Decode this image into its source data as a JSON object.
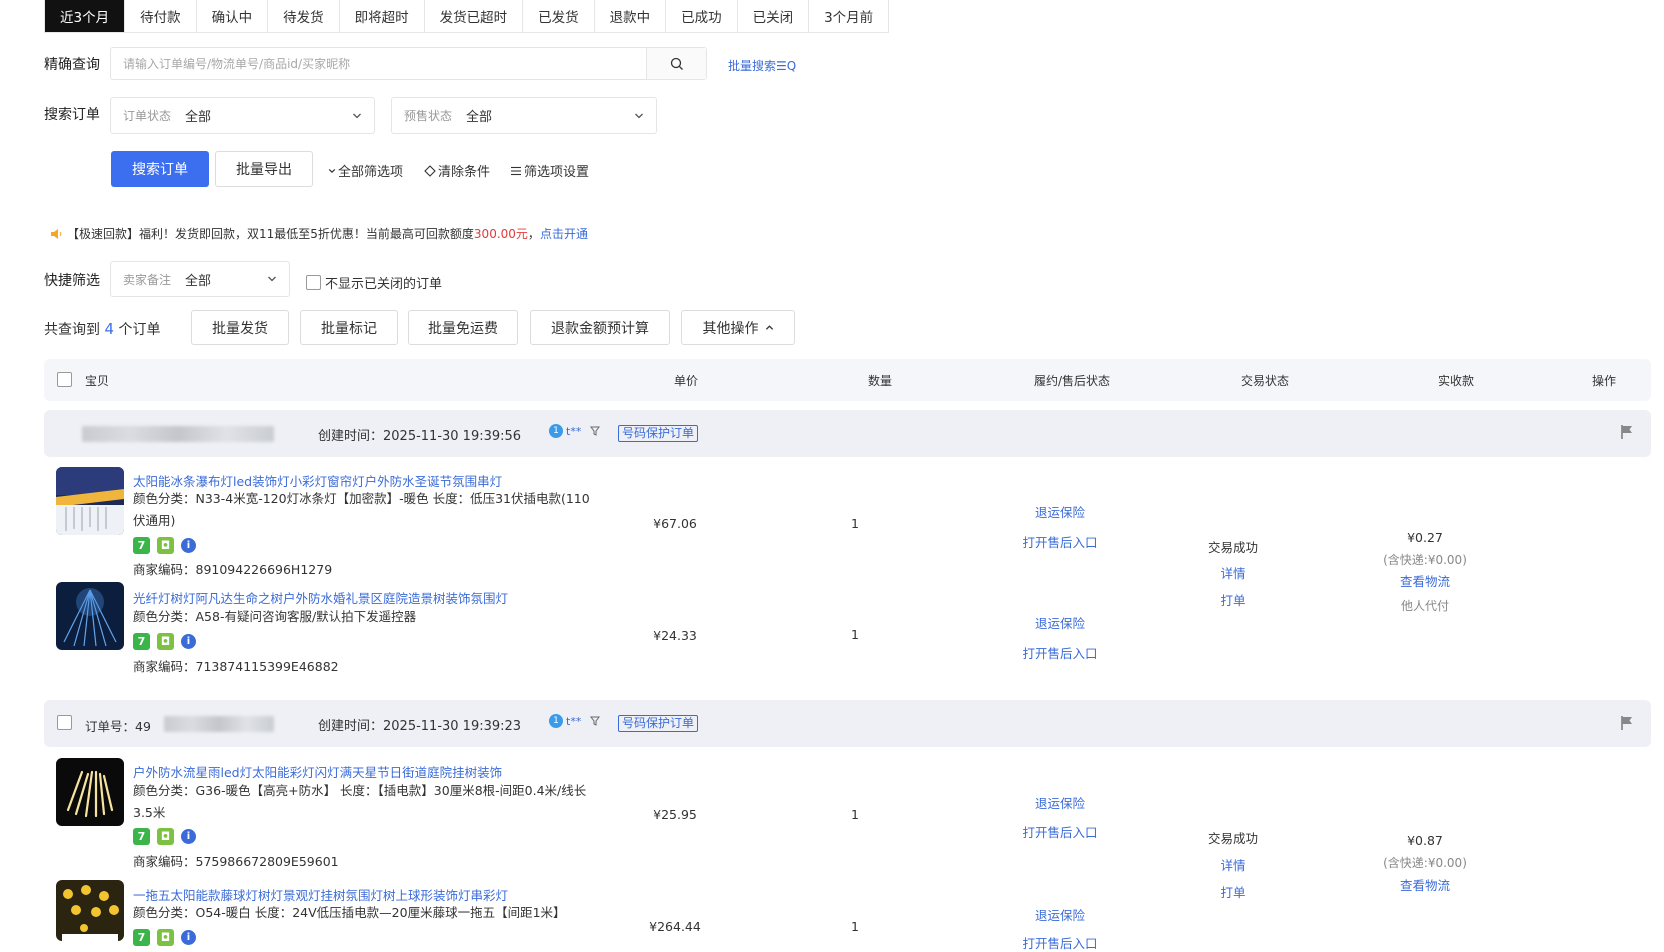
{
  "tabs": [
    {
      "label": "近3个月",
      "active": true
    },
    {
      "label": "待付款"
    },
    {
      "label": "确认中"
    },
    {
      "label": "待发货"
    },
    {
      "label": "即将超时"
    },
    {
      "label": "发货已超时"
    },
    {
      "label": "已发货"
    },
    {
      "label": "退款中"
    },
    {
      "label": "已成功"
    },
    {
      "label": "已关闭"
    },
    {
      "label": "3个月前"
    }
  ],
  "precise_query": {
    "label": "精确查询",
    "placeholder": "请输入订单编号/物流单号/商品id/买家昵称",
    "batch_search": "批量搜索☰Q"
  },
  "search_orders": {
    "label": "搜索订单",
    "order_status": {
      "label": "订单状态",
      "value": "全部"
    },
    "presale_status": {
      "label": "预售状态",
      "value": "全部"
    }
  },
  "actions": {
    "search": "搜索订单",
    "export": "批量导出",
    "all_filters": "全部筛选项",
    "clear": "清除条件",
    "filter_settings": "筛选项设置"
  },
  "notice": {
    "prefix": "【极速回款】福利！发货即回款，双11最低至5折优惠！当前最高可回款额度",
    "amount": "300.00元",
    "comma": "，",
    "link": "点击开通"
  },
  "quick_filter": {
    "label": "快捷筛选",
    "remark": {
      "label": "卖家备注",
      "value": "全部"
    },
    "hide_closed": "不显示已关闭的订单"
  },
  "summary": {
    "prefix": "共查询到",
    "count": "4",
    "suffix": "个订单"
  },
  "bulk_actions": [
    "批量发货",
    "批量标记",
    "批量免运费",
    "退款金额预计算",
    "其他操作"
  ],
  "table_headers": {
    "item": "宝贝",
    "price": "单价",
    "qty": "数量",
    "fulfillment": "履约/售后状态",
    "trade": "交易状态",
    "received": "实收款",
    "ops": "操作"
  },
  "orders": [
    {
      "order_no_label": "",
      "created": "创建时间：2025-11-30 19:39:56",
      "buyer": "t**",
      "tag": "号码保护订单",
      "trade_status": "交易成功",
      "detail": "详情",
      "print": "打单",
      "amount": "¥0.27",
      "shipping": "(含快递:¥0.00)",
      "logistics": "查看物流",
      "proxy": "他人代付",
      "items": [
        {
          "title": "太阳能冰条瀑布灯led装饰灯小彩灯窗帘灯户外防水圣诞节氛围串灯",
          "attr1": "颜色分类：N33-4米宽-120灯冰条灯【加密款】-暖色   长度：低压31伏插电款(110",
          "attr2": "伏通用)",
          "code": "商家编码：891094226696H1279",
          "price": "¥67.06",
          "qty": "1",
          "insurance": "退运保险",
          "after_sale": "打开售后入口"
        },
        {
          "title": "光纤灯树灯阿凡达生命之树户外防水婚礼景区庭院造景树装饰氛围灯",
          "attr1": "颜色分类：A58-有疑问咨询客服/默认拍下发遥控器",
          "attr2": "",
          "code": "商家编码：713874115399E46882",
          "price": "¥24.33",
          "qty": "1",
          "insurance": "退运保险",
          "after_sale": "打开售后入口"
        }
      ]
    },
    {
      "order_no_label": "订单号：49",
      "created": "创建时间：2025-11-30 19:39:23",
      "buyer": "t**",
      "tag": "号码保护订单",
      "trade_status": "交易成功",
      "detail": "详情",
      "print": "打单",
      "amount": "¥0.87",
      "shipping": "(含快递:¥0.00)",
      "logistics": "查看物流",
      "items": [
        {
          "title": "户外防水流星雨led灯太阳能彩灯闪灯满天星节日街道庭院挂树装饰",
          "attr1": "颜色分类：G36-暖色【高亮+防水】   长度：【插电款】30厘米8根-间距0.4米/线长",
          "attr2": "3.5米",
          "code": "商家编码：575986672809E59601",
          "price": "¥25.95",
          "qty": "1",
          "insurance": "退运保险",
          "after_sale": "打开售后入口"
        },
        {
          "title": "一拖五太阳能款藤球灯树灯景观灯挂树氛围灯树上球形装饰灯串彩灯",
          "attr1": "颜色分类：O54-暖白   长度：24V低压插电款—20厘米藤球一拖五【间距1米】",
          "price": "¥264.44",
          "qty": "1",
          "insurance": "退运保险",
          "after_sale": "打开售后入口"
        }
      ]
    }
  ],
  "colors": {
    "accent": "#3c6ff0",
    "link": "#3a6bd8",
    "red": "#e4393c",
    "tab_active_bg": "#111111"
  }
}
